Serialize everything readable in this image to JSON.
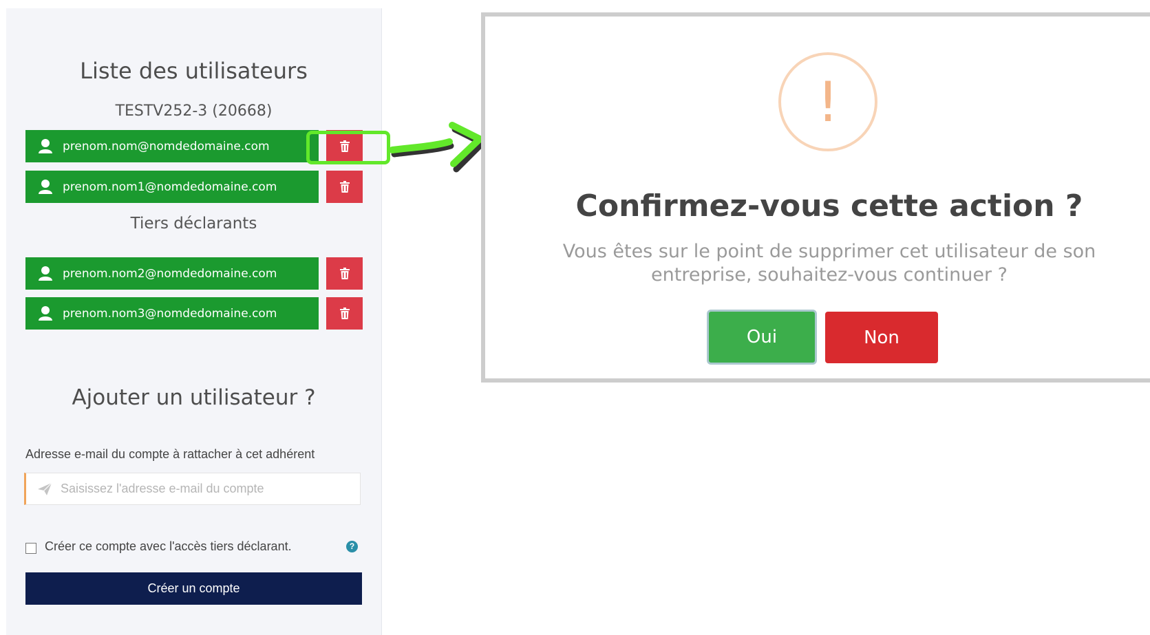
{
  "users_panel": {
    "title": "Liste des utilisateurs",
    "company": "TESTV252-3 (20668)",
    "users": [
      {
        "email": "prenom.nom@nomdedomaine.com",
        "icon": "user-icon",
        "action_icon": "trash-icon"
      },
      {
        "email": "prenom.nom1@nomdedomaine.com",
        "icon": "user-icon",
        "action_icon": "trash-icon"
      }
    ],
    "third_party_title": "Tiers déclarants",
    "third_party_users": [
      {
        "email": "prenom.nom2@nomdedomaine.com",
        "icon": "user-icon",
        "action_icon": "trash-icon"
      },
      {
        "email": "prenom.nom3@nomdedomaine.com",
        "icon": "user-icon",
        "action_icon": "trash-icon"
      }
    ]
  },
  "add_user": {
    "title": "Ajouter un utilisateur ?",
    "email_label": "Adresse e-mail du compte à rattacher à cet adhérent",
    "email_placeholder": "Saisissez l'adresse e-mail du compte",
    "email_value": "",
    "checkbox_label": "Créer ce compte avec l'accès tiers déclarant.",
    "checkbox_checked": false,
    "help_icon": "question-icon",
    "create_button": "Créer un compte"
  },
  "confirm_dialog": {
    "icon": "!",
    "title": "Confirmez-vous cette action ?",
    "message_line1": "Vous êtes sur le point de supprimer cet utilisateur de son",
    "message_line2": "entreprise, souhaitez-vous continuer ?",
    "yes_button": "Oui",
    "no_button": "Non"
  },
  "colors": {
    "user_row": "#1b9a2f",
    "delete_button": "#dc3b48",
    "create_button": "#0e1e4e",
    "yes_button": "#3cae4b",
    "no_button": "#d92a2e",
    "highlight": "#62e82a",
    "warning": "#f3b68a"
  }
}
